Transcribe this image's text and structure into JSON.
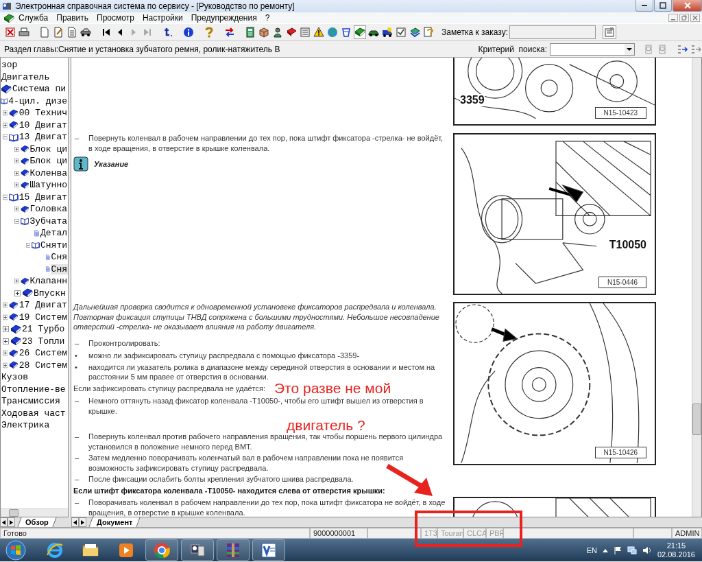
{
  "window": {
    "title": "Электронная справочная система по сервису - [Руководство по ремонту]"
  },
  "menu": [
    {
      "label": "Служба"
    },
    {
      "label": "Править"
    },
    {
      "label": "Просмотр"
    },
    {
      "label": "Настройки"
    },
    {
      "label": "Предупреждения"
    },
    {
      "label": "?"
    }
  ],
  "toolbar": {
    "note_label": "Заметка к заказу:"
  },
  "chapter": {
    "label": "Раздел главы:Снятие и установка зубчатого ремня, ролик-натяжитель В",
    "search_label": "Критерий  поиска:"
  },
  "tree": [
    {
      "label": "зор",
      "kind": "plain",
      "selected": false
    },
    {
      "label": "Двигатель",
      "kind": "plain",
      "selected": false
    },
    {
      "label": "Система пи",
      "kind": "book",
      "selected": false
    },
    {
      "label": "4-цил. дизе",
      "kind": "open-book",
      "selected": false,
      "children": [
        {
          "label": "00 Технич",
          "kind": "book",
          "expanded": false,
          "selected": false
        },
        {
          "label": "10 Двигат",
          "kind": "book",
          "expanded": false,
          "selected": false
        },
        {
          "label": "13 Двигат",
          "kind": "open-book",
          "expanded": true,
          "selected": false,
          "children": [
            {
              "label": "Блок ци",
              "kind": "book",
              "expanded": false,
              "selected": false
            },
            {
              "label": "Блок ци",
              "kind": "book",
              "expanded": false,
              "selected": false
            },
            {
              "label": "Коленва",
              "kind": "book",
              "expanded": false,
              "selected": false
            },
            {
              "label": "Шатунно",
              "kind": "book",
              "expanded": false,
              "selected": false
            }
          ]
        },
        {
          "label": "15 Двигат",
          "kind": "open-book",
          "expanded": true,
          "selected": false,
          "children": [
            {
              "label": "Головка",
              "kind": "book",
              "expanded": false,
              "selected": false
            },
            {
              "label": "Зубчата",
              "kind": "open-book",
              "expanded": true,
              "selected": false,
              "children": [
                {
                  "label": "Детал",
                  "kind": "page",
                  "selected": false
                },
                {
                  "label": "Сняти",
                  "kind": "open-book",
                  "expanded": true,
                  "selected": false,
                  "children": [
                    {
                      "label": "Сня",
                      "kind": "page",
                      "selected": false
                    },
                    {
                      "label": "Сня",
                      "kind": "page",
                      "selected": true
                    }
                  ]
                }
              ]
            },
            {
              "label": "Клапанн",
              "kind": "book",
              "expanded": false,
              "selected": false
            },
            {
              "label": "Впускн",
              "kind": "book",
              "expanded": false,
              "selected": false
            }
          ]
        },
        {
          "label": "17 Двигат",
          "kind": "book",
          "expanded": false,
          "selected": false
        },
        {
          "label": "19 Систем",
          "kind": "book",
          "expanded": false,
          "selected": false
        },
        {
          "label": "21 Турбо",
          "kind": "book",
          "expanded": false,
          "selected": false
        },
        {
          "label": "23 Топли",
          "kind": "book",
          "expanded": false,
          "selected": false
        },
        {
          "label": "26 Систем",
          "kind": "book",
          "expanded": false,
          "selected": false
        },
        {
          "label": "28 Систем",
          "kind": "book",
          "expanded": false,
          "selected": false
        }
      ]
    },
    {
      "label": "Кузов",
      "kind": "plain",
      "selected": false
    },
    {
      "label": "Отопление-ве",
      "kind": "plain",
      "selected": false
    },
    {
      "label": "Трансмиссия",
      "kind": "plain",
      "selected": false
    },
    {
      "label": "Ходовая част",
      "kind": "plain",
      "selected": false
    },
    {
      "label": "Электрика",
      "kind": "plain",
      "selected": false
    }
  ],
  "left_tabs": [
    {
      "label": "Обзор",
      "selected": true
    }
  ],
  "document_tabs": [
    {
      "label": "Документ",
      "selected": true
    }
  ],
  "sections": [
    {
      "figure": {
        "callout": "3359",
        "code": "N15-10423"
      }
    },
    {
      "blocks": [
        {
          "kind": "step",
          "marker": "–",
          "text": "Повернуть коленвал в рабочем направлении до тех пор, пока штифт фиксатора -стрелка- не войдёт, в ходе вращения, в отверстие в крышке коленвала."
        },
        {
          "kind": "note",
          "text": "Указание"
        }
      ],
      "figure": {
        "callout": "T10050",
        "code": "N15-0446"
      }
    },
    {
      "blocks": [
        {
          "kind": "italic",
          "text": "Дальнейшая проверка сводится к одновременной установеке фиксаторов распредвала и коленвала. Повторная фиксация ступицы ТНВД сопряжена с большими трудностями. Небольшое несовпадение отверстий -стрелка- не оказывает влияния на работу двигателя."
        },
        {
          "kind": "step",
          "marker": "–",
          "text": "Проконтролировать:"
        },
        {
          "kind": "bullet",
          "marker": "•",
          "text": "можно ли зафиксировать ступицу распредвала с помощью фиксатора -3359-"
        },
        {
          "kind": "bullet",
          "marker": "•",
          "text": "находится ли указатель ролика в диапазоне между серединой отверстия в основании и местом на расстоянии 5 мм правее от отверстия в основании."
        },
        {
          "kind": "text",
          "text": "Если зафиксировать ступицу распредвала не удаётся:"
        },
        {
          "kind": "step",
          "marker": "–",
          "text": "Немного оттянуть назад фиксатор коленвала -T10050-, чтобы его штифт вышел из отверстия в крышке."
        },
        {
          "kind": "step",
          "marker": "–",
          "text": "Повернуть коленвал против рабочего направления вращения, так чтобы поршень первого цилиндра установился в положение немного перед ВМТ."
        },
        {
          "kind": "step",
          "marker": "–",
          "text": "Затем медленно поворачивать коленчатый вал в рабочем направлении пока не появится возможность зафиксировать ступицу распредвала."
        },
        {
          "kind": "step",
          "marker": "–",
          "text": "После фиксации ослабить болты крепления зубчатого шкива распредвала."
        }
      ],
      "figure": {
        "code": "N15-10426"
      }
    },
    {
      "blocks": [
        {
          "kind": "heading",
          "text": "Если штифт фиксатора коленвала -T10050- находится слева от отверстия крышки:"
        },
        {
          "kind": "step",
          "marker": "–",
          "text": "Поворачивать коленвал в рабочем направлении до тех пор, пока штифт фиксатора не войдёт, в ходе вращения, в отверстие в крышке коленвала."
        }
      ]
    }
  ],
  "annotation": {
    "lines": [
      "Это разве не мой",
      "двигатель ?"
    ]
  },
  "status_bar": [
    {
      "text": "Готово",
      "disabled": false
    },
    {
      "text": "9000000001",
      "disabled": false
    },
    {
      "text": "1T3",
      "disabled": true
    },
    {
      "text": "Touran",
      "disabled": true
    },
    {
      "text": "CLCA",
      "disabled": true
    },
    {
      "text": "PBF",
      "disabled": true
    },
    {
      "text": "ADMIN",
      "disabled": false
    }
  ],
  "taskbar": {
    "language": "EN",
    "time": "21:15",
    "date": "02.08.2016"
  }
}
